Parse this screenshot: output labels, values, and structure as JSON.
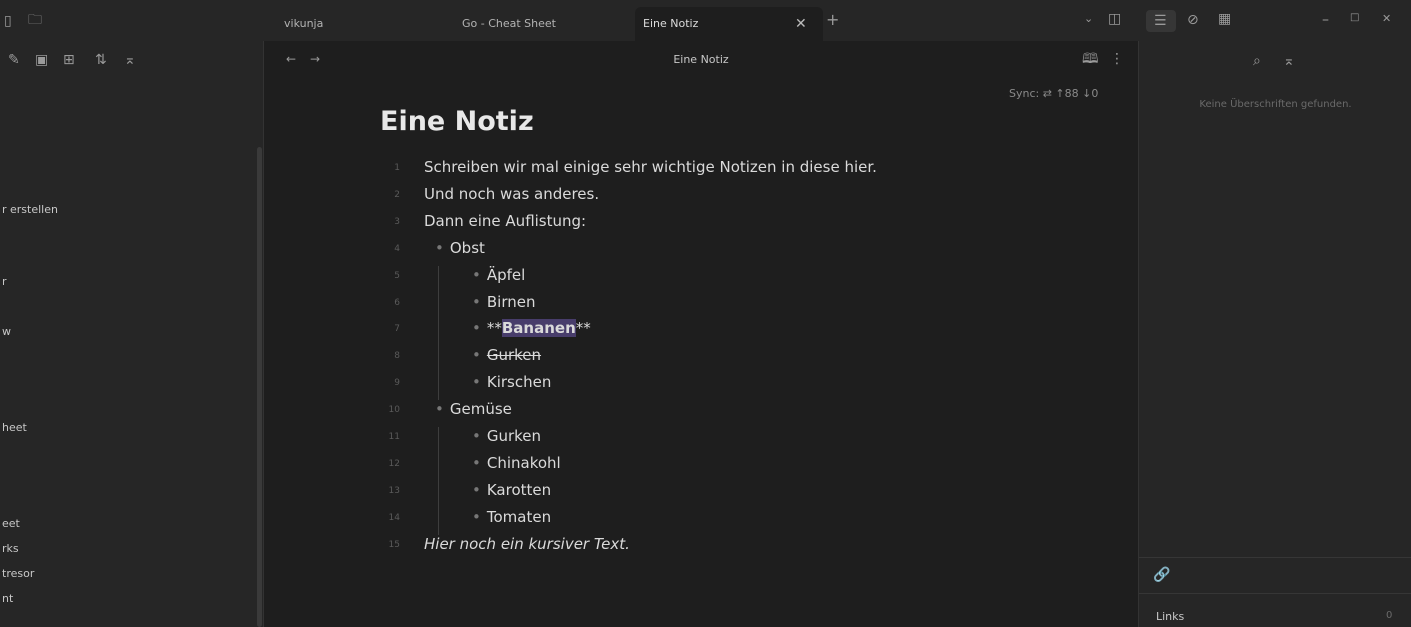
{
  "tabs": [
    {
      "label": "vikunja",
      "active": false
    },
    {
      "label": "Go - Cheat Sheet",
      "active": false
    },
    {
      "label": "Eine Notiz",
      "active": true
    }
  ],
  "editor": {
    "header_title": "Eine Notiz",
    "sync": "Sync: ⇄ ↑88 ↓0",
    "title": "Eine Notiz",
    "lines": [
      {
        "n": "1",
        "text": "Schreiben wir mal einige sehr wichtige Notizen in diese hier.",
        "indent": 0,
        "bullet": false
      },
      {
        "n": "2",
        "text": "Und noch was anderes.",
        "indent": 0,
        "bullet": false
      },
      {
        "n": "3",
        "text": "Dann eine Auflistung:",
        "indent": 0,
        "bullet": false
      },
      {
        "n": "4",
        "text": "Obst",
        "indent": 1,
        "bullet": true
      },
      {
        "n": "5",
        "text": "Äpfel",
        "indent": 2,
        "bullet": true
      },
      {
        "n": "6",
        "text": "Birnen",
        "indent": 2,
        "bullet": true
      },
      {
        "n": "7",
        "text": "**Bananen**",
        "indent": 2,
        "bullet": true
      },
      {
        "n": "8",
        "text": "Gurken",
        "indent": 2,
        "bullet": true,
        "strike": true
      },
      {
        "n": "9",
        "text": "Kirschen",
        "indent": 2,
        "bullet": true
      },
      {
        "n": "10",
        "text": "Gemüse",
        "indent": 1,
        "bullet": true
      },
      {
        "n": "11",
        "text": "Gurken",
        "indent": 2,
        "bullet": true
      },
      {
        "n": "12",
        "text": "Chinakohl",
        "indent": 2,
        "bullet": true
      },
      {
        "n": "13",
        "text": "Karotten",
        "indent": 2,
        "bullet": true
      },
      {
        "n": "14",
        "text": "Tomaten",
        "indent": 2,
        "bullet": true
      },
      {
        "n": "15",
        "text": "Hier noch ein kursiver Text.",
        "indent": 0,
        "bullet": false,
        "italic": true
      }
    ]
  },
  "left_sidebar": {
    "items": [
      "r erstellen",
      "r",
      "w",
      "heet",
      "eet",
      "rks",
      "tresor",
      "nt"
    ]
  },
  "right_sidebar": {
    "empty_text": "Keine Überschriften gefunden.",
    "links_label": "Links",
    "links_count": "0"
  },
  "colors": {
    "accent": "#7f6df2",
    "selection": "#483d6b"
  }
}
